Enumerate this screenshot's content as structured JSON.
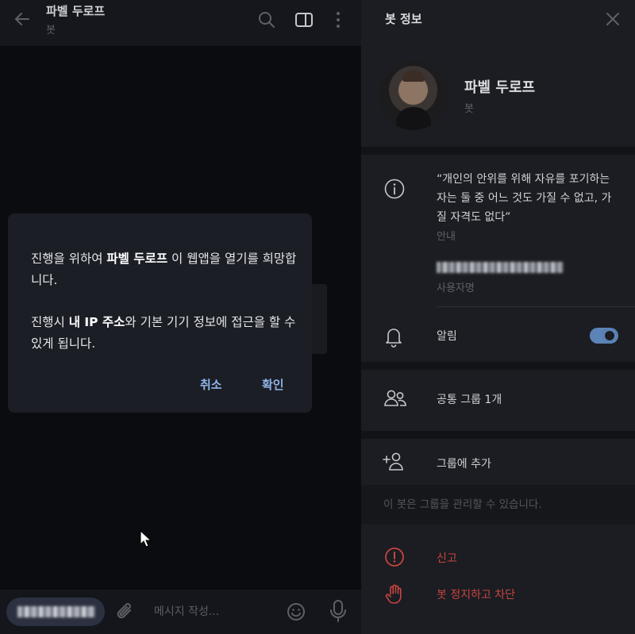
{
  "chat": {
    "title": "파벨 두로프",
    "subtitle": "봇",
    "composer": {
      "placeholder": "메시지 작성..."
    }
  },
  "dialog": {
    "line1_pre": "진행을 위하여 ",
    "line1_name": "파벨 두로프",
    "line1_post": " 이 웹앱을 열기를 희망합니다.",
    "line2_pre": "진행시 ",
    "line2_bold": "내 IP 주소",
    "line2_post": "와 기본 기기 정보에 접근을 할 수 있게 됩니다.",
    "cancel": "취소",
    "confirm": "확인"
  },
  "panel": {
    "title": "봇 정보",
    "profile": {
      "name": "파벨 두로프",
      "sub": "봇"
    },
    "bio": "“개인의 안위를 위해 자유를 포기하는 자는 둘 중 어느 것도 가질 수 없고, 가질 자격도 없다”",
    "bio_label": "안내",
    "username_label": "사용자명",
    "notifications_label": "알림",
    "notifications_on": true,
    "common_groups": "공통 그룹 1개",
    "add_to_group": "그룹에 추가",
    "hint": "이 봇은 그룹을 관리할 수 있습니다.",
    "report": "신고",
    "block": "봇 정지하고 차단"
  },
  "colors": {
    "accent": "#8fb4ea",
    "toggle": "#5c84b8",
    "danger": "#c9443f",
    "panel_bg": "#1b1d22",
    "chat_bg": "#0b0c10"
  }
}
